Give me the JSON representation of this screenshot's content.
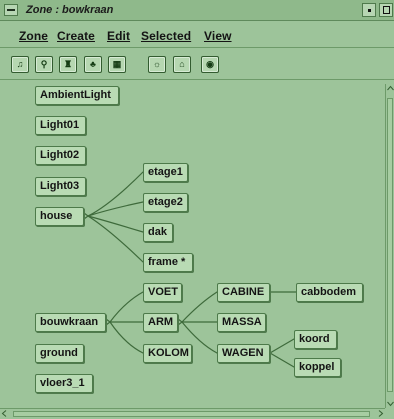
{
  "window": {
    "title": "Zone : bowkraan"
  },
  "menubar": {
    "items": [
      "Zone",
      "Create",
      "Edit",
      "Selected",
      "View"
    ]
  },
  "toolbar": {
    "icons": [
      {
        "name": "note-icon"
      },
      {
        "name": "figure-icon"
      },
      {
        "name": "scene-icon"
      },
      {
        "name": "tree-icon"
      },
      {
        "name": "grid-icon"
      },
      {
        "name": "light-icon"
      },
      {
        "name": "door-icon"
      },
      {
        "name": "eye-icon"
      }
    ]
  },
  "tree": {
    "nodes": [
      "AmbientLight",
      "Light01",
      "Light02",
      "Light03",
      "house",
      "etage1",
      "etage2",
      "dak",
      "frame *",
      "bouwkraan",
      "VOET",
      "ARM",
      "KOLOM",
      "CABINE",
      "MASSA",
      "WAGEN",
      "cabbodem",
      "koord",
      "koppel",
      "ground",
      "vloer3_1"
    ]
  }
}
